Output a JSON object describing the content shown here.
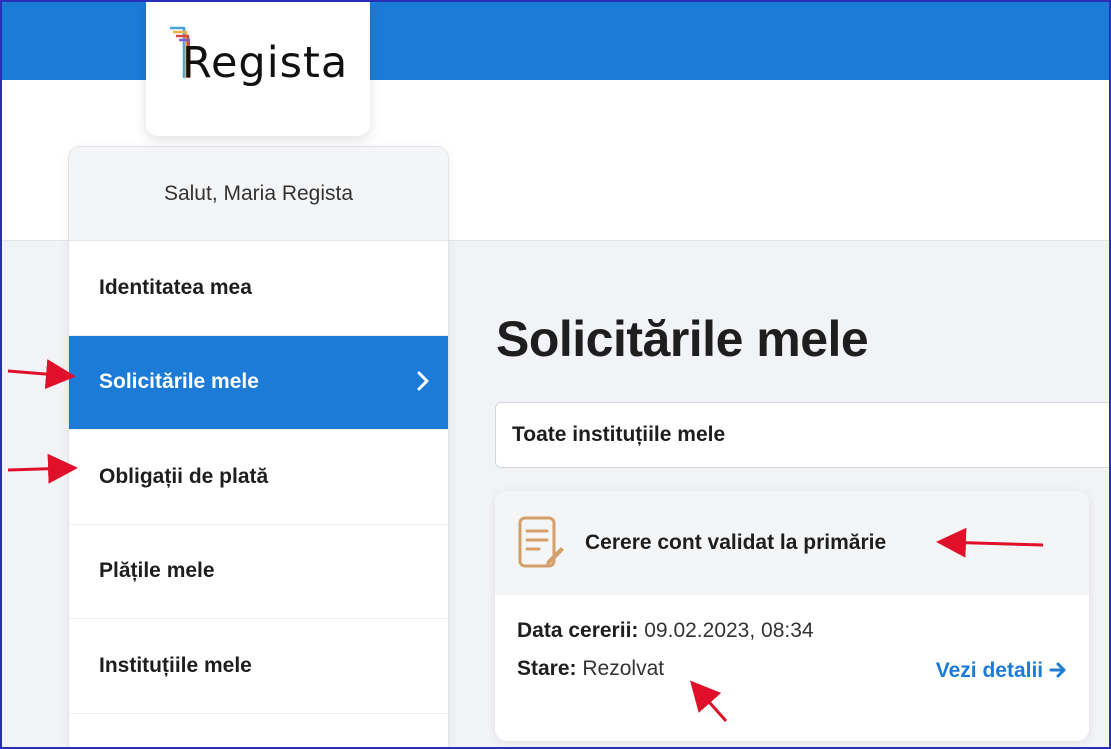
{
  "app": {
    "logo_text": "Regista"
  },
  "sidebar": {
    "greeting": "Salut, Maria Regista",
    "items": [
      {
        "label": "Identitatea mea",
        "active": false
      },
      {
        "label": "Solicitările mele",
        "active": true
      },
      {
        "label": "Obligații de plată",
        "active": false
      },
      {
        "label": "Plățile mele",
        "active": false
      },
      {
        "label": "Instituțiile mele",
        "active": false
      }
    ]
  },
  "main": {
    "title": "Solicitările mele",
    "filter_value": "Toate instituțiile mele",
    "request": {
      "title": "Cerere cont validat la primărie",
      "date_label": "Data cererii:",
      "date_value": "09.02.2023, 08:34",
      "status_label": "Stare:",
      "status_value": "Rezolvat",
      "details_link": "Vezi detalii"
    }
  },
  "colors": {
    "brand_blue": "#1d7bd8",
    "annotation_red": "#e0102a",
    "document_icon": "#d4a06a"
  },
  "icons": {
    "active_chevron": "chevron-right-icon",
    "request": "document-edit-icon",
    "details": "arrow-right-icon"
  }
}
